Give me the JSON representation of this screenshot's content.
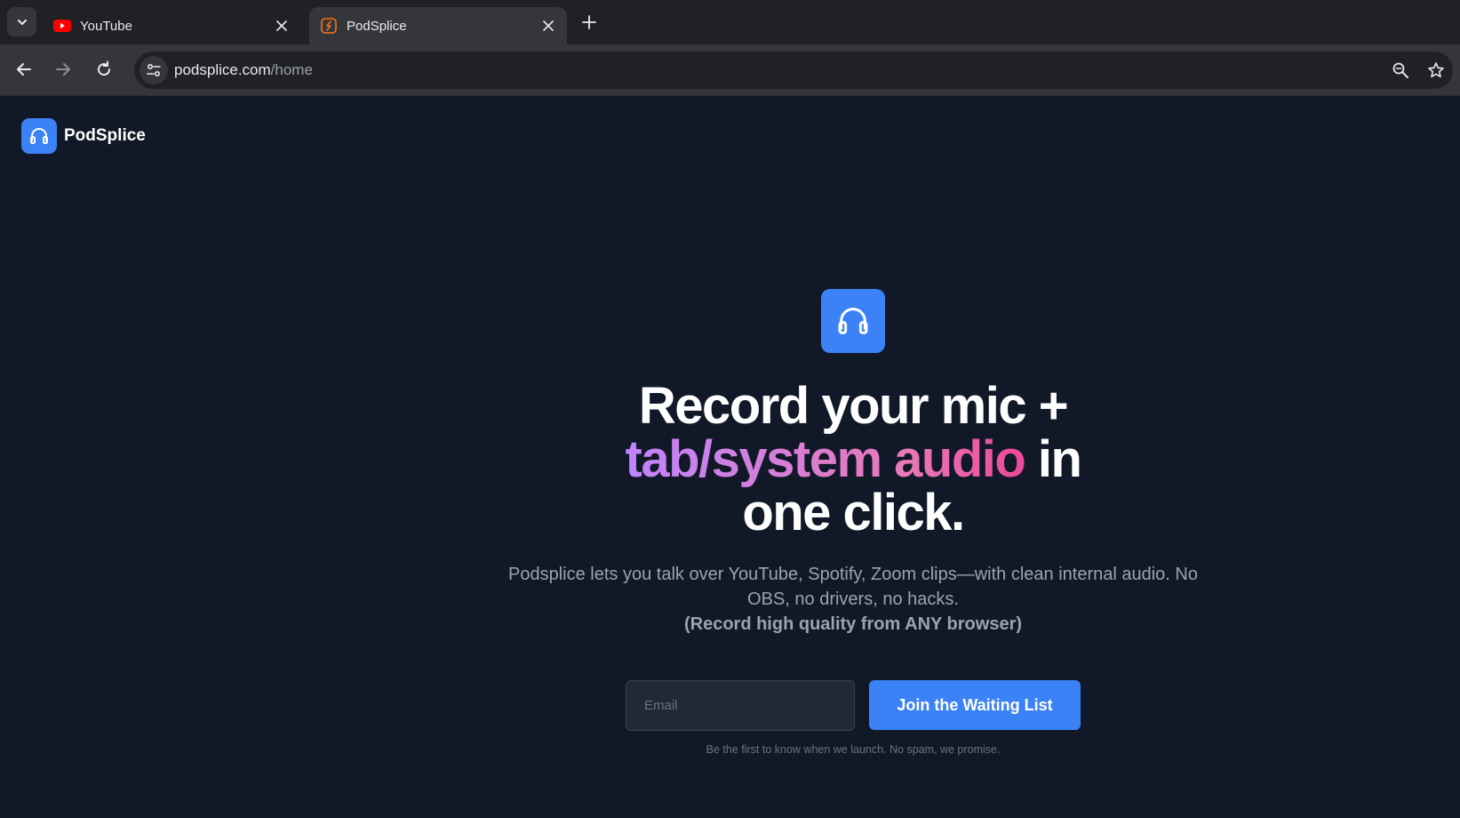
{
  "browser": {
    "tabs": [
      {
        "title": "YouTube",
        "icon": "youtube-icon",
        "active": false
      },
      {
        "title": "PodSplice",
        "icon": "podsplice-favicon",
        "active": true
      }
    ],
    "url": {
      "host": "podsplice.com",
      "path": "/home"
    }
  },
  "page": {
    "brand": {
      "name": "PodSplice",
      "logo_icon": "headphones-icon"
    },
    "hero": {
      "icon": "headphones-icon",
      "headline_part1": "Record your mic +",
      "headline_highlight": "tab/system audio",
      "headline_part2": " in",
      "headline_part3": "one click.",
      "subtext": "Podsplice lets you talk over YouTube, Spotify, Zoom clips—with clean internal audio. No OBS, no drivers, no hacks.",
      "subtext_bold": "(Record high quality from ANY browser)"
    },
    "signup": {
      "email_placeholder": "Email",
      "email_value": "",
      "button_label": "Join the Waiting List",
      "note": "Be the first to know when we launch. No spam, we promise."
    }
  },
  "colors": {
    "page_bg": "#111827",
    "accent": "#3b82f6",
    "gradient_start": "#c084fc",
    "gradient_end": "#ec4899"
  }
}
